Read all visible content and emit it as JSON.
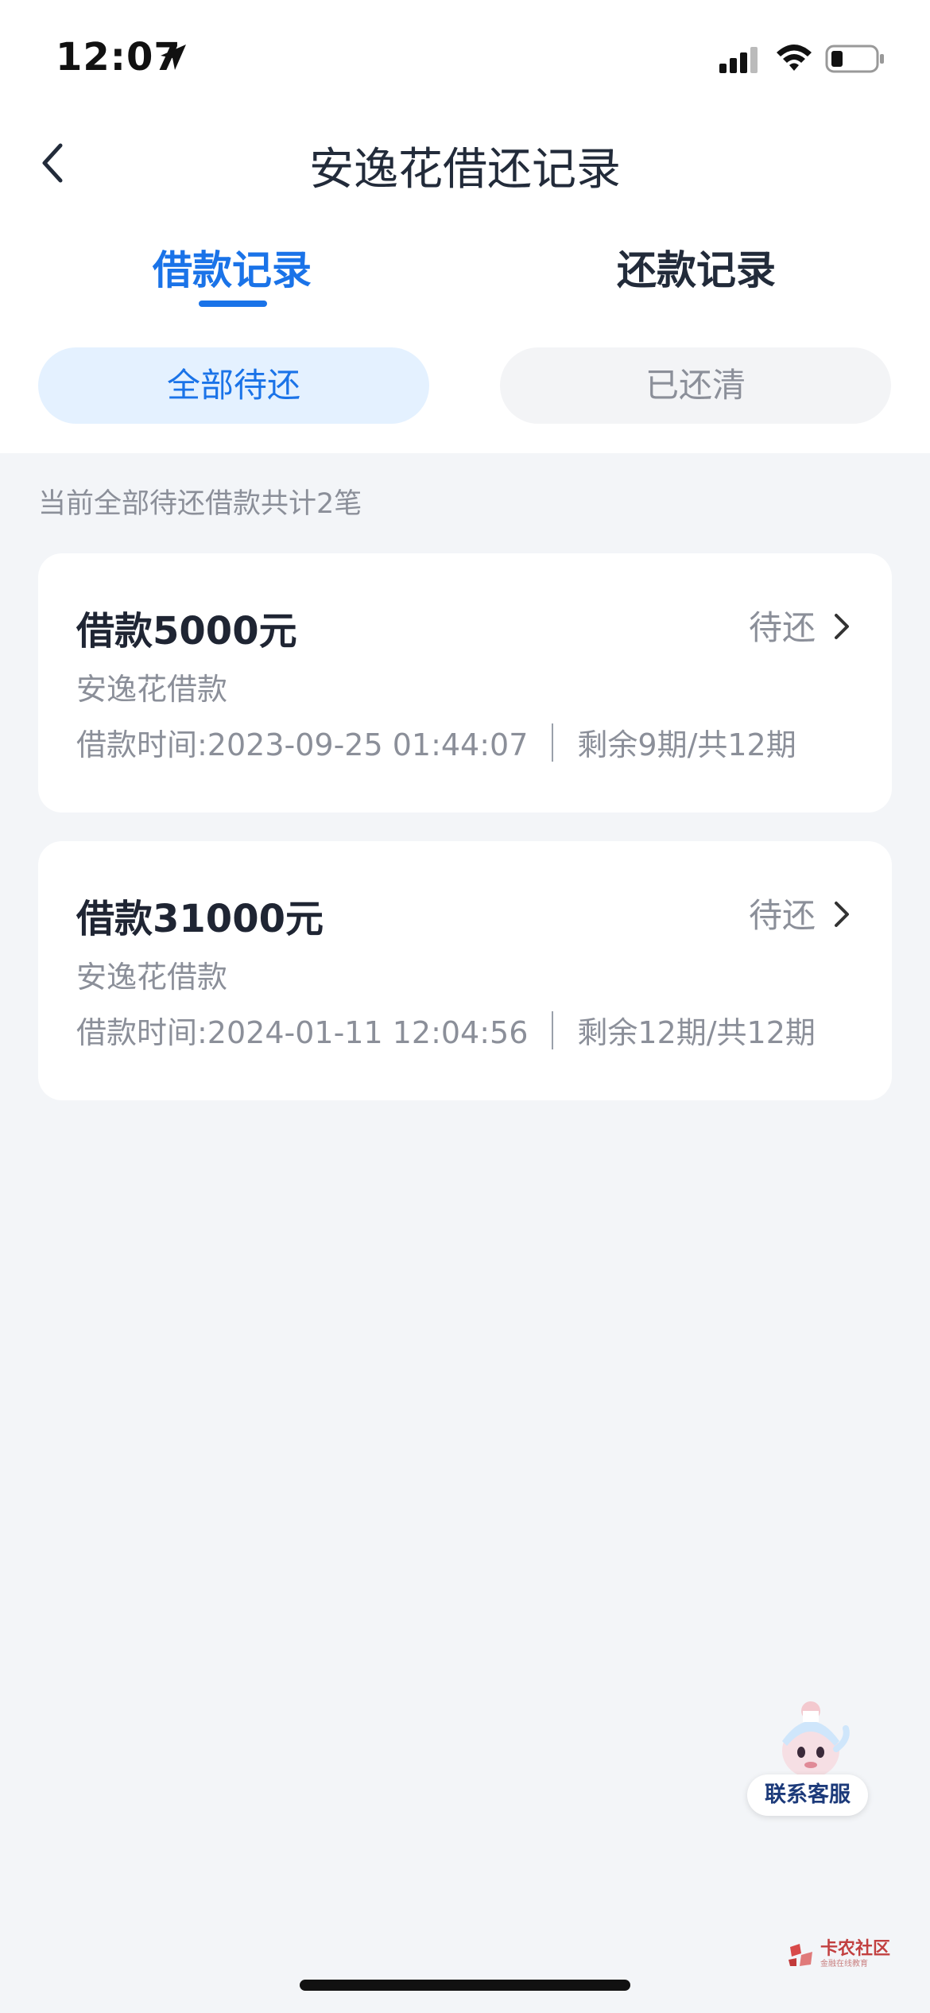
{
  "status_bar": {
    "time": "12:07"
  },
  "nav": {
    "title": "安逸花借还记录"
  },
  "tabs": [
    {
      "label": "借款记录",
      "active": true
    },
    {
      "label": "还款记录",
      "active": false
    }
  ],
  "filters": [
    {
      "label": "全部待还",
      "active": true
    },
    {
      "label": "已还清",
      "active": false
    }
  ],
  "summary": "当前全部待还借款共计2笔",
  "loans": [
    {
      "amount": "借款5000元",
      "status": "待还",
      "product": "安逸花借款",
      "time": "借款时间:2023-09-25 01:44:07",
      "periods": "剩余9期/共12期"
    },
    {
      "amount": "借款31000元",
      "status": "待还",
      "product": "安逸花借款",
      "time": "借款时间:2024-01-11 12:04:56",
      "periods": "剩余12期/共12期"
    }
  ],
  "customer_service": {
    "label": "联系客服"
  },
  "watermark": {
    "main": "卡农社区",
    "sub": "金融在线教育"
  },
  "colors": {
    "accent": "#1a73e8",
    "text_primary": "#1f2533",
    "text_secondary": "#8b8f99",
    "background": "#f3f5f8"
  }
}
